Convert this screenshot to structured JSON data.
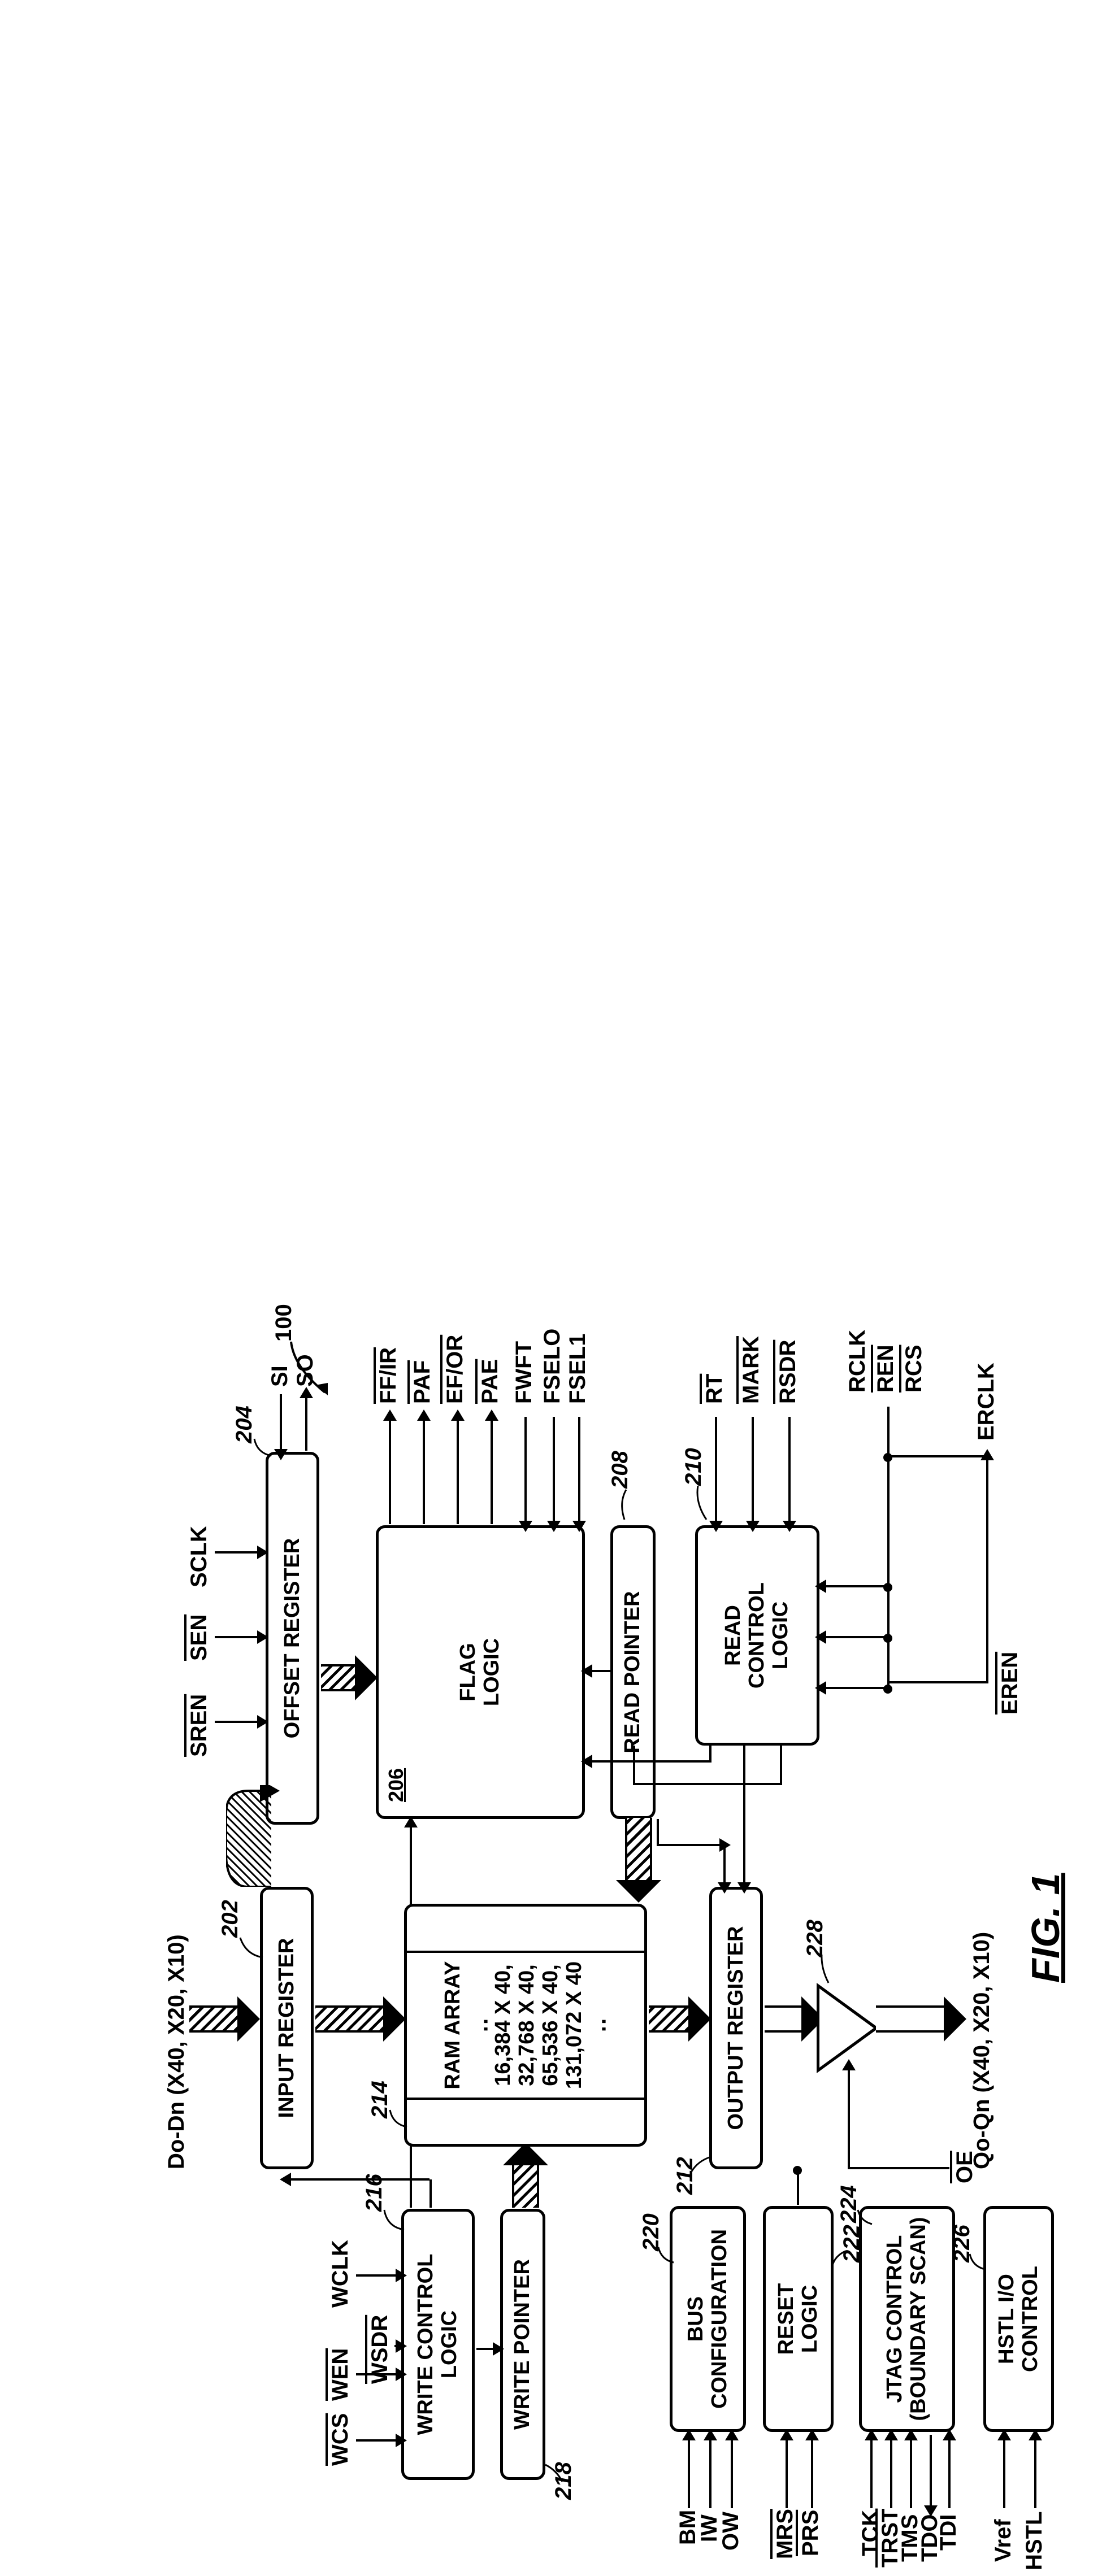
{
  "fig": "FIG. 1",
  "ref": {
    "main": "100",
    "input_reg": "202",
    "offset_reg": "204",
    "flag_logic": "206",
    "read_ptr": "208",
    "read_ctrl": "210",
    "output_reg": "212",
    "ram": "214",
    "write_ctrl": "216",
    "write_ptr": "218",
    "bus_cfg": "220",
    "reset": "222",
    "jtag": "224",
    "hstl": "226",
    "buffer": "228"
  },
  "blocks": {
    "input_reg": "INPUT REGISTER",
    "offset_reg": "OFFSET REGISTER",
    "write_ctrl": "WRITE CONTROL\nLOGIC",
    "write_ptr": "WRITE POINTER",
    "ram_title": "RAM ARRAY",
    "ram_lines": [
      "16,384 X 40,",
      "32,768 X 40,",
      "65,536 X 40,",
      "131,072 X 40"
    ],
    "flag_logic": "FLAG\nLOGIC",
    "read_ptr": "READ POINTER",
    "output_reg": "OUTPUT REGISTER",
    "read_ctrl": "READ\nCONTROL\nLOGIC",
    "bus_cfg": "BUS\nCONFIGURATION",
    "reset": "RESET\nLOGIC",
    "jtag": "JTAG CONTROL\n(BOUNDARY SCAN)",
    "hstl": "HSTL I/O\nCONTROL"
  },
  "signals": {
    "top_data": "Do-Dn (X40, X20, X10)",
    "bottom_data": "Qo-Qn (X40, X20, X10)",
    "sren": "SREN",
    "sen": "SEN",
    "sclk": "SCLK",
    "si": "SI",
    "so": "SO",
    "wcs": "WCS",
    "wen": "WEN",
    "wclk": "WCLK",
    "wsdr": "WSDR",
    "ff_ir": "FF/IR",
    "paf": "PAF",
    "ef_or": "EF/OR",
    "pae": "PAE",
    "fwft": "FWFT",
    "fselo": "FSELO",
    "fsel1": "FSEL1",
    "rt": "RT",
    "mark": "MARK",
    "rsdr": "RSDR",
    "rclk": "RCLK",
    "ren": "REN",
    "rcs": "RCS",
    "eren": "EREN",
    "erclk": "ERCLK",
    "oe": "OE",
    "bm": "BM",
    "iw": "IW",
    "ow": "OW",
    "mrs": "MRS",
    "prs": "PRS",
    "tck": "TCK",
    "trst": "TRST",
    "tms": "TMS",
    "tdo": "TDO",
    "tdi": "TDI",
    "vref": "Vref",
    "hstl_sig": "HSTL"
  }
}
